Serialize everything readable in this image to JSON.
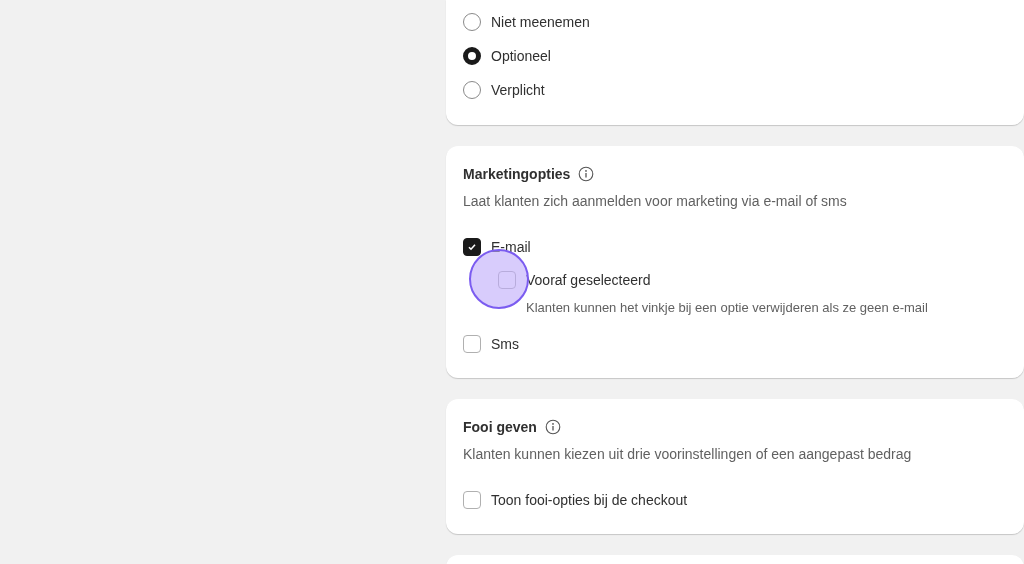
{
  "sections": [
    {
      "kind": "radios",
      "options": [
        {
          "label": "Niet meenemen",
          "selected": false
        },
        {
          "label": "Optioneel",
          "selected": true
        },
        {
          "label": "Verplicht",
          "selected": false
        }
      ]
    },
    {
      "kind": "checks",
      "title": "Marketingopties",
      "info": true,
      "description": "Laat klanten zich aanmelden voor marketing via e-mail of sms",
      "options": [
        {
          "label": "E-mail",
          "checked": true,
          "children": [
            {
              "label": "Vooraf geselecteerd",
              "checked": false,
              "hint": "Klanten kunnen het vinkje bij een optie verwijderen als ze geen e-mail",
              "pointer": true
            }
          ]
        },
        {
          "label": "Sms",
          "checked": false
        }
      ]
    },
    {
      "kind": "checks",
      "title": "Fooi geven",
      "info": true,
      "description": "Klanten kunnen kiezen uit drie voorinstellingen of een aangepast bedrag",
      "options": [
        {
          "label": "Toon fooi-opties bij de checkout",
          "checked": false
        }
      ]
    },
    {
      "kind": "empty"
    }
  ]
}
